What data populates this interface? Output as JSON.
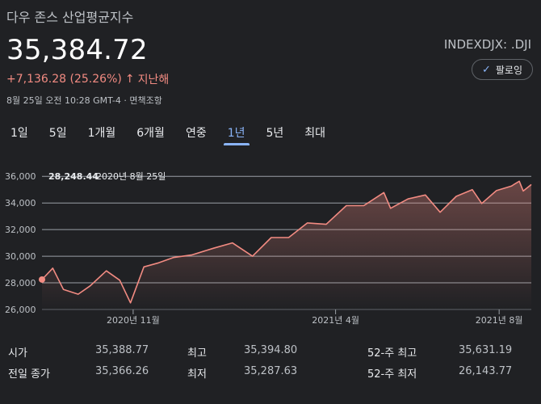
{
  "header": {
    "title": "다우 존스 산업평균지수",
    "price": "35,384.72",
    "change": "+7,136.28 (25.26%)",
    "change_arrow": "↑",
    "change_period": "지난해",
    "timestamp": "8월 25일 오전 10:28 GMT-4 · 면책조항",
    "ticker": "INDEXDJX: .DJI",
    "follow_label": "팔로잉"
  },
  "tabs": [
    {
      "label": "1일"
    },
    {
      "label": "5일"
    },
    {
      "label": "1개월"
    },
    {
      "label": "6개월"
    },
    {
      "label": "연중"
    },
    {
      "label": "1년"
    },
    {
      "label": "5년"
    },
    {
      "label": "최대"
    }
  ],
  "active_tab": "1년",
  "chart_data": {
    "type": "area",
    "ylim": [
      26000,
      36500
    ],
    "y_ticks": [
      "36,000",
      "34,000",
      "32,000",
      "30,000",
      "28,000",
      "26,000"
    ],
    "y_tick_values": [
      36000,
      34000,
      32000,
      30000,
      28000,
      26000
    ],
    "x_ticks": [
      "2020년 11월",
      "2021년 4월",
      "2021년 8월"
    ],
    "reference_value": "28,248.44",
    "reference_date": "2020년 8월 25일",
    "x": [
      "2020-08-25",
      "2020-09-02",
      "2020-09-10",
      "2020-09-21",
      "2020-09-30",
      "2020-10-12",
      "2020-10-22",
      "2020-10-30",
      "2020-11-09",
      "2020-11-20",
      "2020-12-01",
      "2020-12-15",
      "2020-12-31",
      "2021-01-14",
      "2021-01-29",
      "2021-02-12",
      "2021-02-25",
      "2021-03-11",
      "2021-03-25",
      "2021-04-09",
      "2021-04-22",
      "2021-05-07",
      "2021-05-12",
      "2021-05-25",
      "2021-06-07",
      "2021-06-18",
      "2021-06-30",
      "2021-07-12",
      "2021-07-19",
      "2021-07-30",
      "2021-08-10",
      "2021-08-16",
      "2021-08-19",
      "2021-08-25"
    ],
    "values": [
      28248,
      29100,
      27500,
      27150,
      27780,
      28900,
      28200,
      26500,
      29200,
      29500,
      29900,
      30100,
      30600,
      31000,
      30000,
      31400,
      31400,
      32500,
      32400,
      33800,
      33800,
      34780,
      33600,
      34300,
      34600,
      33300,
      34500,
      35000,
      33960,
      34930,
      35260,
      35630,
      34900,
      35385
    ],
    "line_color": "#f28b82",
    "grid": true
  },
  "stats": {
    "open_label": "시가",
    "open_value": "35,388.77",
    "prev_close_label": "전일 종가",
    "prev_close_value": "35,366.26",
    "high_label": "최고",
    "high_value": "35,394.80",
    "low_label": "최저",
    "low_value": "35,287.63",
    "wk52_high_label": "52-주 최고",
    "wk52_high_value": "35,631.19",
    "wk52_low_label": "52-주 최저",
    "wk52_low_value": "26,143.77"
  }
}
